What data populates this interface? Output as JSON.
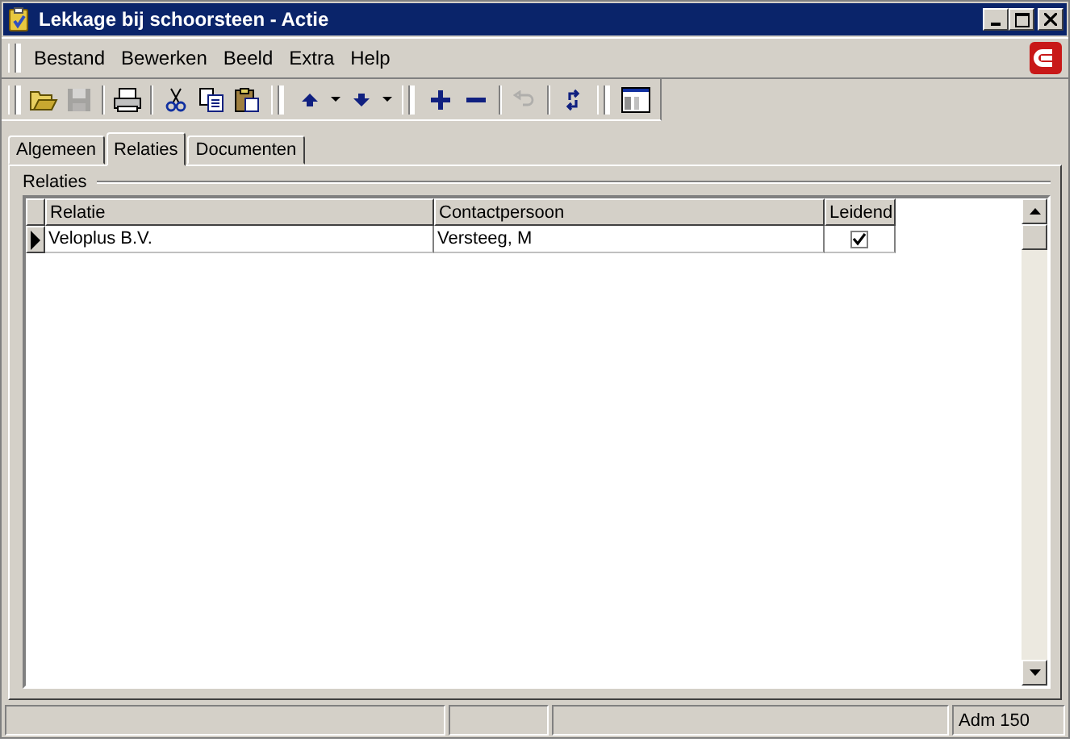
{
  "window": {
    "title": "Lekkage bij schoorsteen - Actie"
  },
  "menu": [
    "Bestand",
    "Bewerken",
    "Beeld",
    "Extra",
    "Help"
  ],
  "toolbar": [
    {
      "kind": "grip"
    },
    {
      "kind": "open",
      "disabled": false
    },
    {
      "kind": "save",
      "disabled": true
    },
    {
      "kind": "sep"
    },
    {
      "kind": "print",
      "disabled": false
    },
    {
      "kind": "sep"
    },
    {
      "kind": "cut",
      "disabled": false
    },
    {
      "kind": "copy",
      "disabled": false
    },
    {
      "kind": "paste",
      "disabled": false
    },
    {
      "kind": "grip"
    },
    {
      "kind": "up",
      "disabled": false
    },
    {
      "kind": "drop",
      "disabled": false
    },
    {
      "kind": "down",
      "disabled": false
    },
    {
      "kind": "drop",
      "disabled": false
    },
    {
      "kind": "grip"
    },
    {
      "kind": "plus",
      "disabled": false
    },
    {
      "kind": "minus",
      "disabled": false
    },
    {
      "kind": "sep"
    },
    {
      "kind": "undo",
      "disabled": true
    },
    {
      "kind": "sep"
    },
    {
      "kind": "refresh",
      "disabled": false
    },
    {
      "kind": "grip"
    },
    {
      "kind": "layout",
      "disabled": false
    }
  ],
  "tabs": [
    {
      "label": "Algemeen",
      "selected": false
    },
    {
      "label": "Relaties",
      "selected": true
    },
    {
      "label": "Documenten",
      "selected": false
    }
  ],
  "group": {
    "title": "Relaties"
  },
  "table": {
    "columns": [
      "Relatie",
      "Contactpersoon",
      "Leidend"
    ],
    "rows": [
      {
        "relatie": "Veloplus B.V.",
        "contact": "Versteeg, M",
        "leidend": true,
        "selected": true
      }
    ]
  },
  "status_bar": {
    "text": "Adm 150"
  }
}
